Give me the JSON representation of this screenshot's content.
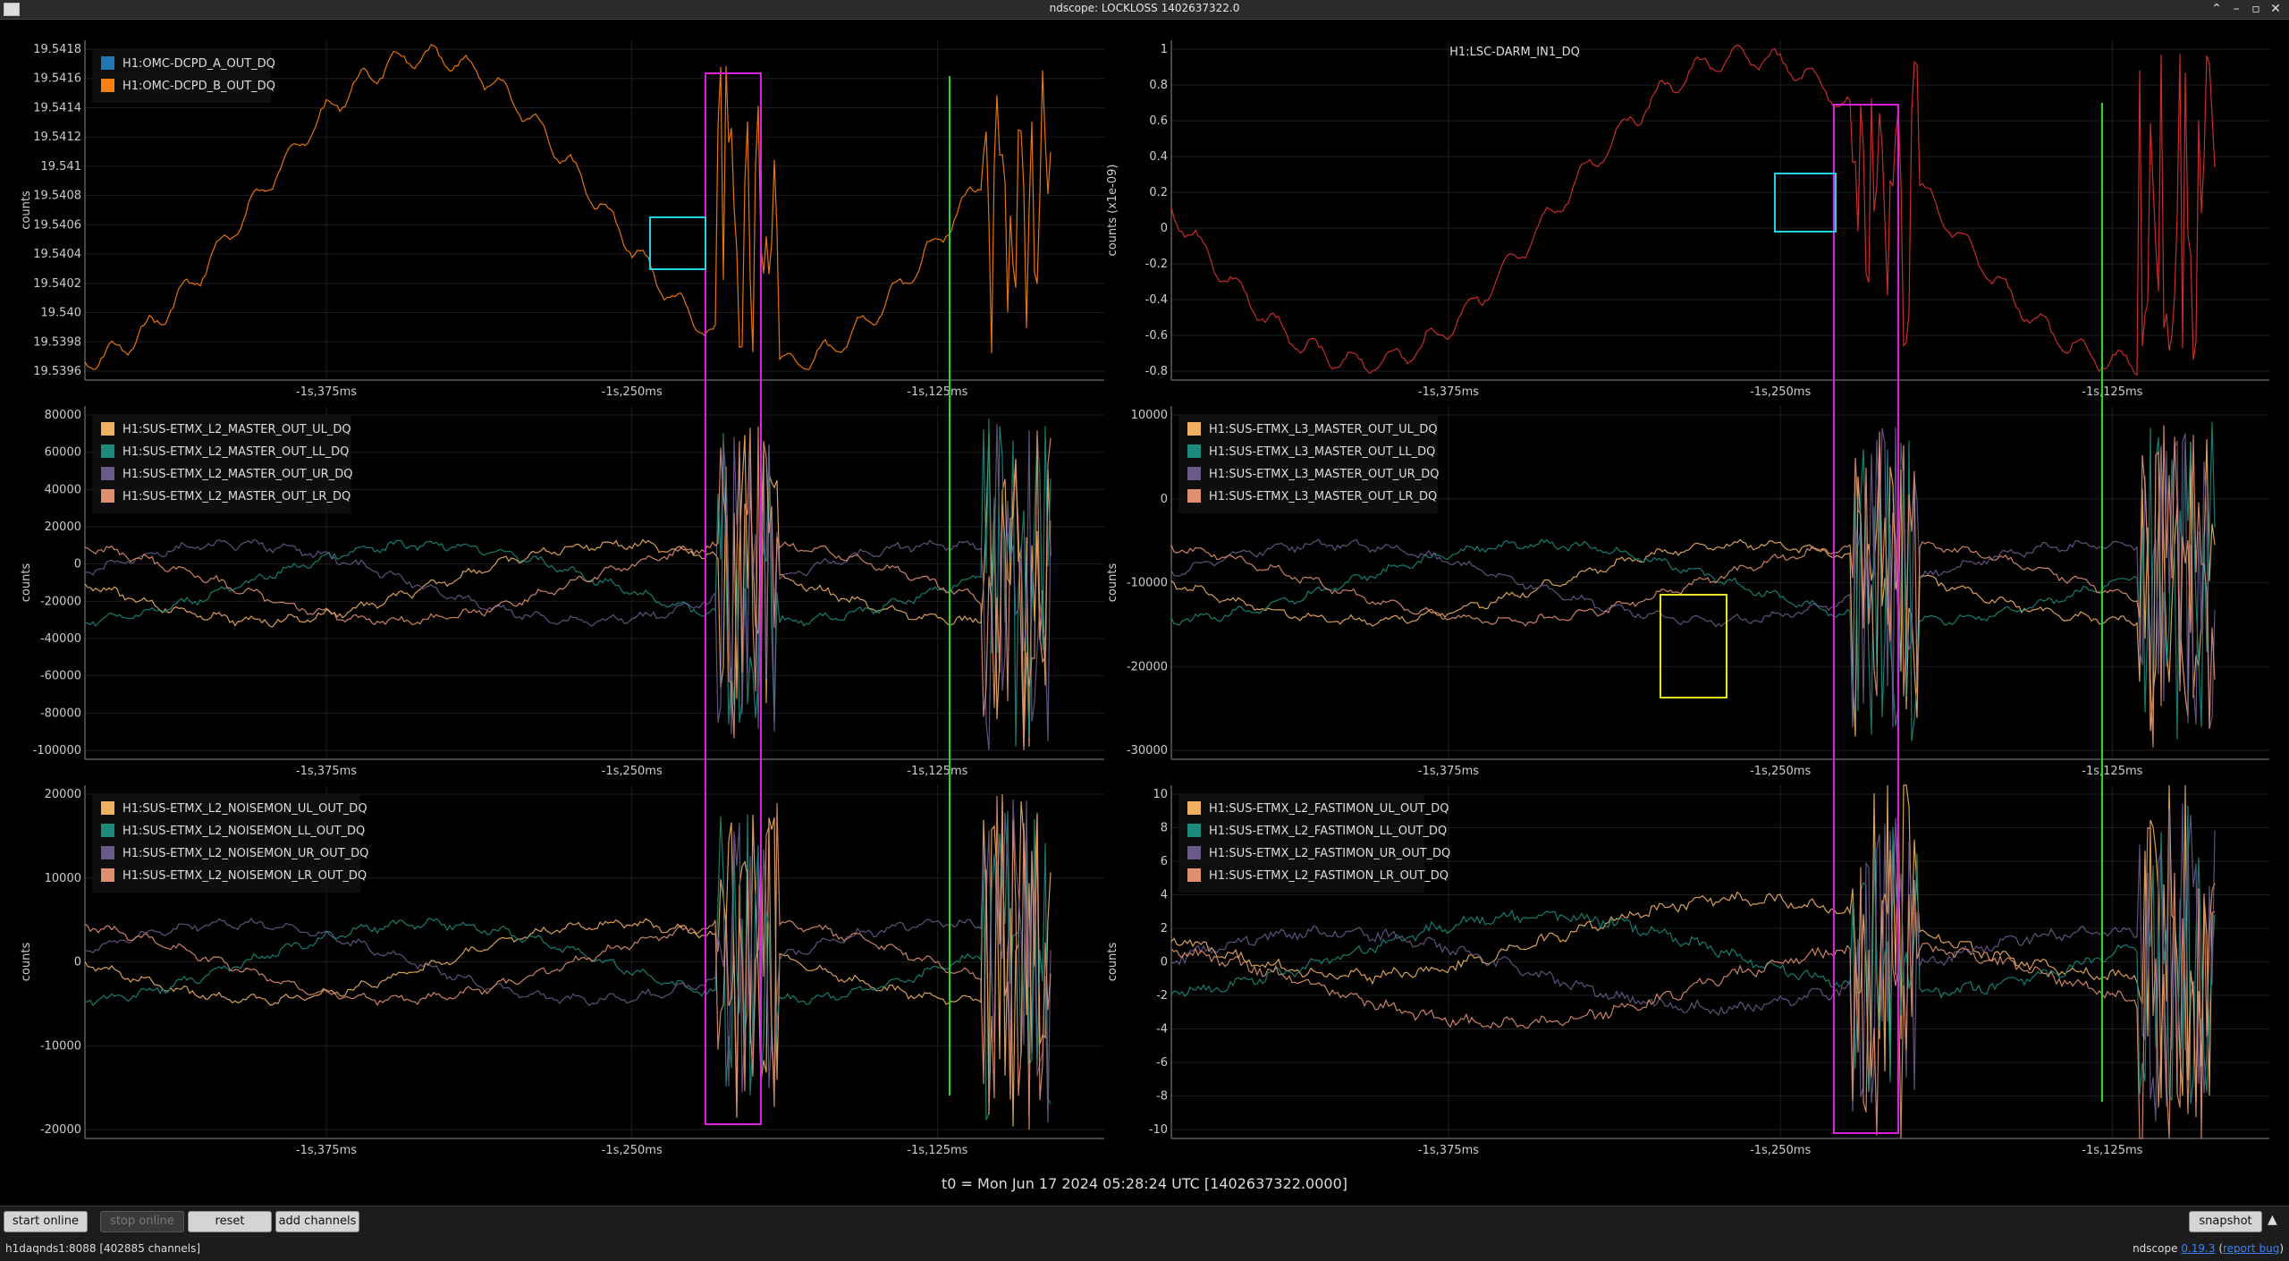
{
  "window": {
    "title": "ndscope: LOCKLOSS 1402637322.0"
  },
  "x_ticks": [
    "-1s,375ms",
    "-1s,250ms",
    "-1s,125ms"
  ],
  "colors": {
    "green_marker": "#22dd22",
    "magenta_box": "#dd22dd",
    "cyan_box": "#22d3e6",
    "yellow_box": "#e6e622"
  },
  "plots": [
    {
      "id": "p1",
      "ylabel": "counts",
      "title": "",
      "yticks": [
        "19.5418",
        "19.5416",
        "19.5414",
        "19.5412",
        "19.541",
        "19.5408",
        "19.5406",
        "19.5404",
        "19.5402",
        "19.540",
        "19.5398",
        "19.5396"
      ],
      "legend": [
        {
          "label": "H1:OMC-DCPD_A_OUT_DQ",
          "color": "#1f77b4"
        },
        {
          "label": "H1:OMC-DCPD_B_OUT_DQ",
          "color": "#ff7f0e"
        }
      ]
    },
    {
      "id": "p2",
      "ylabel": "counts (x1e-09)",
      "title": "H1:LSC-DARM_IN1_DQ",
      "yticks": [
        "1",
        "0.8",
        "0.6",
        "0.4",
        "0.2",
        "0",
        "-0.2",
        "-0.4",
        "-0.6",
        "-0.8"
      ],
      "legend": []
    },
    {
      "id": "p3",
      "ylabel": "counts",
      "title": "",
      "yticks": [
        "80000",
        "60000",
        "40000",
        "20000",
        "0",
        "-20000",
        "-40000",
        "-60000",
        "-80000",
        "-100000"
      ],
      "legend": [
        {
          "label": "H1:SUS-ETMX_L2_MASTER_OUT_UL_DQ",
          "color": "#f0b060"
        },
        {
          "label": "H1:SUS-ETMX_L2_MASTER_OUT_LL_DQ",
          "color": "#1a8a7a"
        },
        {
          "label": "H1:SUS-ETMX_L2_MASTER_OUT_UR_DQ",
          "color": "#6a5a8a"
        },
        {
          "label": "H1:SUS-ETMX_L2_MASTER_OUT_LR_DQ",
          "color": "#e09070"
        }
      ]
    },
    {
      "id": "p4",
      "ylabel": "counts",
      "title": "",
      "yticks": [
        "10000",
        "0",
        "-10000",
        "-20000",
        "-30000"
      ],
      "legend": [
        {
          "label": "H1:SUS-ETMX_L3_MASTER_OUT_UL_DQ",
          "color": "#f0b060"
        },
        {
          "label": "H1:SUS-ETMX_L3_MASTER_OUT_LL_DQ",
          "color": "#1a8a7a"
        },
        {
          "label": "H1:SUS-ETMX_L3_MASTER_OUT_UR_DQ",
          "color": "#6a5a8a"
        },
        {
          "label": "H1:SUS-ETMX_L3_MASTER_OUT_LR_DQ",
          "color": "#e09070"
        }
      ]
    },
    {
      "id": "p5",
      "ylabel": "counts",
      "title": "",
      "yticks": [
        "20000",
        "10000",
        "0",
        "-10000",
        "-20000"
      ],
      "legend": [
        {
          "label": "H1:SUS-ETMX_L2_NOISEMON_UL_OUT_DQ",
          "color": "#f0b060"
        },
        {
          "label": "H1:SUS-ETMX_L2_NOISEMON_LL_OUT_DQ",
          "color": "#1a8a7a"
        },
        {
          "label": "H1:SUS-ETMX_L2_NOISEMON_UR_OUT_DQ",
          "color": "#6a5a8a"
        },
        {
          "label": "H1:SUS-ETMX_L2_NOISEMON_LR_OUT_DQ",
          "color": "#e09070"
        }
      ]
    },
    {
      "id": "p6",
      "ylabel": "counts",
      "title": "",
      "yticks": [
        "10",
        "8",
        "6",
        "4",
        "2",
        "0",
        "-2",
        "-4",
        "-6",
        "-8",
        "-10"
      ],
      "legend": [
        {
          "label": "H1:SUS-ETMX_L2_FASTIMON_UL_OUT_DQ",
          "color": "#f0b060"
        },
        {
          "label": "H1:SUS-ETMX_L2_FASTIMON_LL_OUT_DQ",
          "color": "#1a8a7a"
        },
        {
          "label": "H1:SUS-ETMX_L2_FASTIMON_UR_OUT_DQ",
          "color": "#6a5a8a"
        },
        {
          "label": "H1:SUS-ETMX_L2_FASTIMON_LR_OUT_DQ",
          "color": "#e09070"
        }
      ]
    }
  ],
  "t0_label": "t0 = Mon Jun 17 2024 05:28:24 UTC [1402637322.0000]",
  "toolbar": {
    "start_online": "start online",
    "stop_online": "stop online",
    "reset": "reset",
    "add_channels": "add channels",
    "snapshot": "snapshot"
  },
  "status": {
    "server": "h1daqnds1:8088  [402885 channels]"
  },
  "version": {
    "prefix": "ndscope",
    "number": "0.19.3",
    "report": "report bug"
  }
}
